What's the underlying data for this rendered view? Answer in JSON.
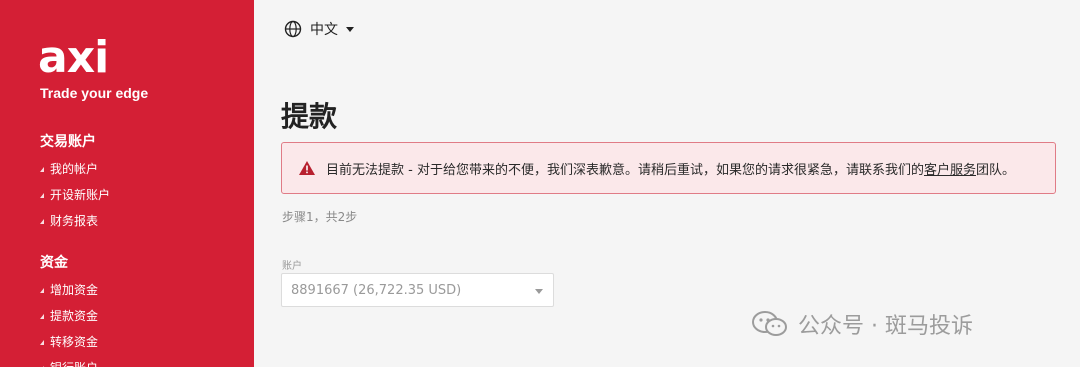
{
  "sidebar": {
    "logo": "axi",
    "tagline": "Trade your edge",
    "sections": [
      {
        "title": "交易账户",
        "items": [
          "我的帐户",
          "开设新账户",
          "财务报表"
        ]
      },
      {
        "title": "资金",
        "items": [
          "增加资金",
          "提款资金",
          "转移资金",
          "银行账户"
        ]
      }
    ]
  },
  "header": {
    "language": "中文",
    "language_icon": "globe-icon"
  },
  "main": {
    "title": "提款",
    "alert": {
      "icon": "warning-icon",
      "text": "目前无法提款 - 对于给您带来的不便，我们深表歉意。请稍后重试，如果您的请求很紧急，请联系我们的",
      "link": "客户服务",
      "suffix": "团队。"
    },
    "step": "步骤1，共2步",
    "account_label": "账户",
    "account_value": "8891667 (26,722.35 USD)"
  },
  "watermark": {
    "text": "公众号 · 斑马投诉",
    "icon": "wechat-icon"
  },
  "colors": {
    "brand": "#d41f35",
    "alert_bg": "#fbe8ea",
    "alert_border": "#e07b86"
  }
}
